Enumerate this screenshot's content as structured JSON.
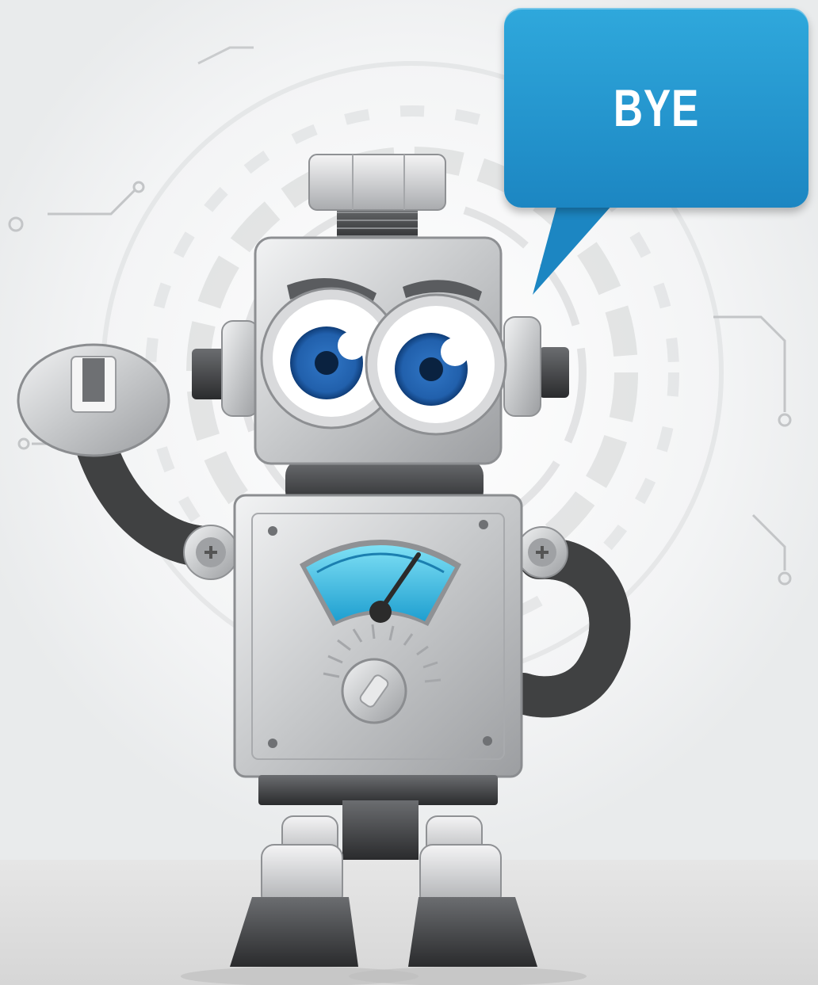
{
  "speech_bubble": {
    "text": "BYE"
  },
  "colors": {
    "bubble": "#1f8fcc",
    "eye_iris": "#1e5fa8",
    "gauge": "#4cc6e8",
    "metal": "#c9cbcd",
    "hose": "#2b2b2b",
    "floor": "#e3e3e3",
    "background": "#f4f5f6"
  },
  "icons": [
    "robot-character",
    "wrench-hand",
    "gauge-dial",
    "speech-bubble"
  ]
}
